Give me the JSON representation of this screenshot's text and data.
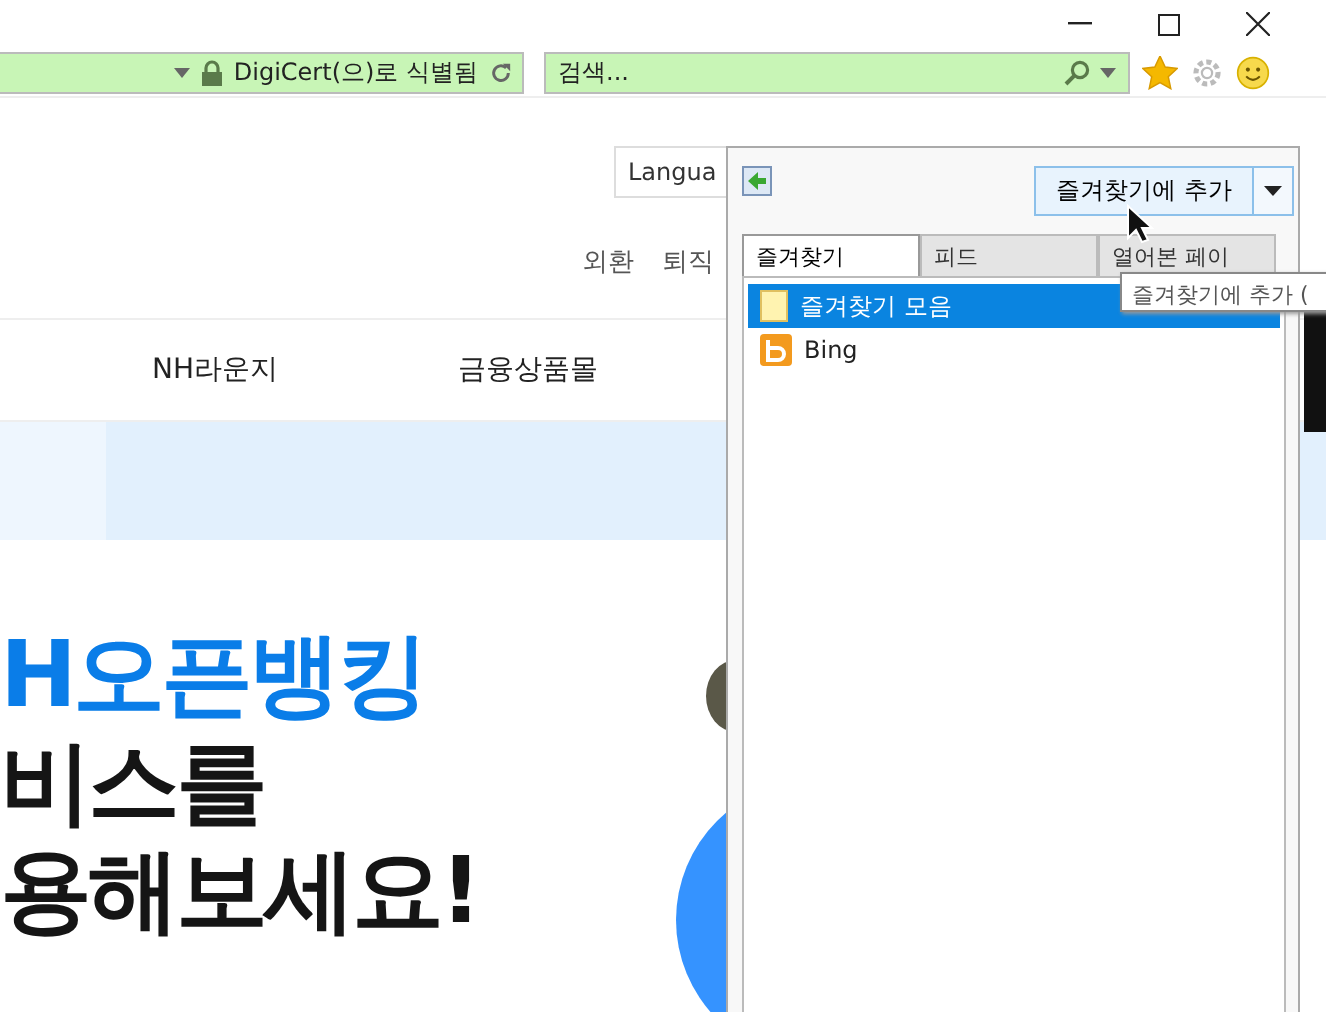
{
  "address_bar": {
    "identity": "DigiCert(으)로 식별됨",
    "secure": true
  },
  "search": {
    "placeholder": "검색..."
  },
  "page": {
    "language_field": "Langua",
    "links": [
      "외환",
      "퇴직"
    ],
    "nav": [
      "NH라운지",
      "금융상품몰"
    ],
    "headline": [
      {
        "text": "H오픈뱅킹",
        "kind": "accent"
      },
      {
        "text": "비스를",
        "kind": "plain"
      },
      {
        "text": "용해보세요!",
        "kind": "plain"
      }
    ]
  },
  "favorites_panel": {
    "add_button": "즐겨찾기에 추가",
    "tabs": [
      {
        "label": "즐겨찾기",
        "selected": true
      },
      {
        "label": "피드",
        "selected": false
      },
      {
        "label": "열어본 페이",
        "selected": false
      }
    ],
    "items": [
      {
        "label": "즐겨찾기 모음",
        "kind": "folder",
        "selected": true
      },
      {
        "label": "Bing",
        "kind": "site",
        "selected": false
      }
    ],
    "tooltip": "즐겨찾기에 추가 ("
  }
}
